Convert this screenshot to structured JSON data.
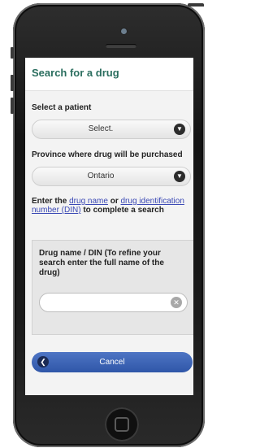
{
  "header": {
    "title": "Search for a drug"
  },
  "patient": {
    "label": "Select a patient",
    "value": "Select."
  },
  "province": {
    "label": "Province where drug will be purchased",
    "value": "Ontario"
  },
  "instructions": {
    "prefix": "Enter the ",
    "link1": "drug name",
    "mid": " or ",
    "link2": "drug identification number (DIN)",
    "suffix": " to complete a search"
  },
  "drug_search": {
    "label": "Drug name / DIN (To refine your search enter the full name of the drug)",
    "value": ""
  },
  "footer": {
    "cancel_label": "Cancel"
  },
  "icons": {
    "select_chevron": "chevron-down-icon",
    "clear": "clear-icon",
    "back": "back-icon"
  }
}
